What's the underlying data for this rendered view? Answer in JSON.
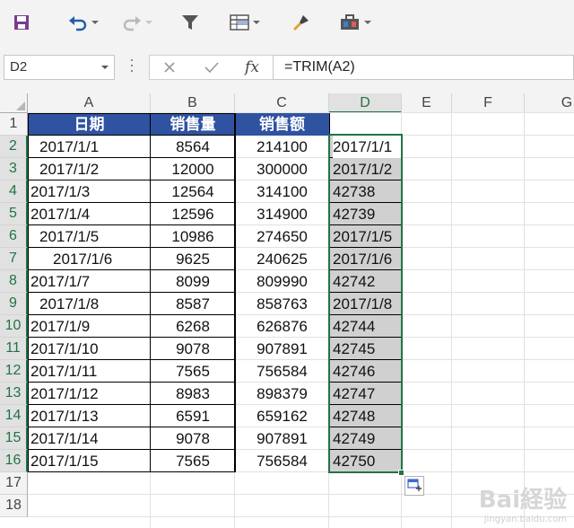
{
  "formula_bar": {
    "name_box": "D2",
    "fx_label": "fx",
    "formula": "=TRIM(A2)"
  },
  "columns": [
    "A",
    "B",
    "C",
    "D",
    "E",
    "F",
    "G"
  ],
  "rows": [
    "1",
    "2",
    "3",
    "4",
    "5",
    "6",
    "7",
    "8",
    "9",
    "10",
    "11",
    "12",
    "13",
    "14",
    "15",
    "16",
    "17",
    "18"
  ],
  "headers": [
    "日期",
    "销售量",
    "销售额"
  ],
  "data": [
    {
      "date": "2017/1/1",
      "qty": "8564",
      "amount": "214100",
      "d": "2017/1/1"
    },
    {
      "date": "2017/1/2",
      "qty": "12000",
      "amount": "300000",
      "d": "2017/1/2"
    },
    {
      "date": "2017/1/3",
      "qty": "12564",
      "amount": "314100",
      "d": "42738"
    },
    {
      "date": "2017/1/4",
      "qty": "12596",
      "amount": "314900",
      "d": "42739"
    },
    {
      "date": "2017/1/5",
      "qty": "10986",
      "amount": "274650",
      "d": "2017/1/5"
    },
    {
      "date": "2017/1/6",
      "qty": "9625",
      "amount": "240625",
      "d": "2017/1/6"
    },
    {
      "date": "2017/1/7",
      "qty": "8099",
      "amount": "809990",
      "d": "42742"
    },
    {
      "date": "2017/1/8",
      "qty": "8587",
      "amount": "858763",
      "d": "2017/1/8"
    },
    {
      "date": "2017/1/9",
      "qty": "6268",
      "amount": "626876",
      "d": "42744"
    },
    {
      "date": "2017/1/10",
      "qty": "9078",
      "amount": "907891",
      "d": "42745"
    },
    {
      "date": "2017/1/11",
      "qty": "7565",
      "amount": "756584",
      "d": "42746"
    },
    {
      "date": "2017/1/12",
      "qty": "8983",
      "amount": "898379",
      "d": "42747"
    },
    {
      "date": "2017/1/13",
      "qty": "6591",
      "amount": "659162",
      "d": "42748"
    },
    {
      "date": "2017/1/14",
      "qty": "9078",
      "amount": "907891",
      "d": "42749"
    },
    {
      "date": "2017/1/15",
      "qty": "7565",
      "amount": "756584",
      "d": "42750"
    }
  ],
  "date_indent": [
    "s2",
    "s2",
    "s0",
    "s0",
    "s2",
    "s6",
    "s0",
    "s2",
    "s0",
    "s0",
    "s0",
    "s0",
    "s0",
    "s0",
    "s0"
  ],
  "toolbar_icons": [
    "save-icon",
    "undo-icon",
    "redo-icon",
    "filter-icon",
    "table-format-icon",
    "format-painter-icon",
    "toolbox-icon"
  ],
  "watermark": {
    "logo": "Bai経验",
    "url": "jingyan.baidu.com"
  },
  "colors": {
    "header_fill": "#2f52a1",
    "selection": "#217346",
    "selected_fill": "#d0d0d0"
  }
}
